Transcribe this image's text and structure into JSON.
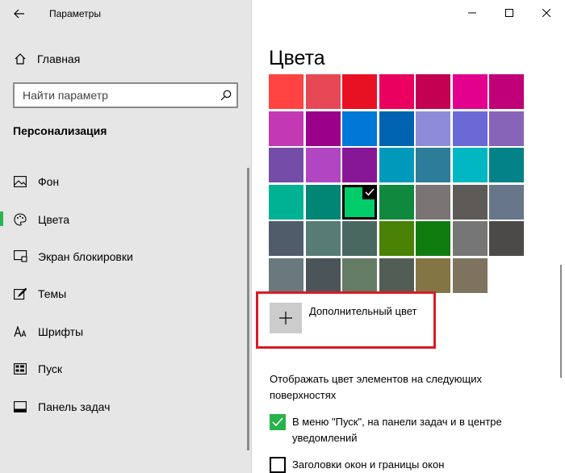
{
  "window": {
    "title": "Параметры",
    "controls": [
      "minimize",
      "maximize",
      "close"
    ]
  },
  "sidebar": {
    "home_label": "Главная",
    "search_placeholder": "Найти параметр",
    "section_heading": "Персонализация",
    "items": [
      {
        "label": "Фон",
        "icon": "picture-icon",
        "active": false
      },
      {
        "label": "Цвета",
        "icon": "palette-icon",
        "active": true
      },
      {
        "label": "Экран блокировки",
        "icon": "lock-screen-icon",
        "active": false
      },
      {
        "label": "Темы",
        "icon": "brush-icon",
        "active": false
      },
      {
        "label": "Шрифты",
        "icon": "font-icon",
        "active": false
      },
      {
        "label": "Пуск",
        "icon": "start-icon",
        "active": false
      },
      {
        "label": "Панель задач",
        "icon": "taskbar-icon",
        "active": false
      }
    ]
  },
  "main": {
    "title": "Цвета",
    "swatches": [
      [
        "#ff4343",
        "#e74856",
        "#e81123",
        "#ea005e",
        "#c30052",
        "#e3008c",
        "#bf0077"
      ],
      [
        "#c239b3",
        "#9a0089",
        "#0078d7",
        "#0063b1",
        "#8e8cd8",
        "#6b69d6",
        "#8764b8"
      ],
      [
        "#744da9",
        "#b146c2",
        "#881798",
        "#0099bc",
        "#2d7d9a",
        "#00b7c3",
        "#038387"
      ],
      [
        "#00b294",
        "#018574",
        "#00cc6a",
        "#10893e",
        "#7a7574",
        "#5d5a58",
        "#68768a"
      ],
      [
        "#515c6b",
        "#567c73",
        "#486860",
        "#498205",
        "#107c10",
        "#767676",
        "#4c4a48"
      ],
      [
        "#69797e",
        "#4a5459",
        "#647c64",
        "#525e54",
        "#847545",
        "#7e735f"
      ]
    ],
    "selected_swatch": "#00cc6a",
    "custom_color_label": "Дополнительный цвет",
    "highlight_color": "#d81b27",
    "show_color_label": "Отображать цвет элементов на следующих поверхностях",
    "checkboxes": [
      {
        "label": "В меню \"Пуск\", на панели задач и в центре уведомлений",
        "checked": true
      },
      {
        "label": "Заголовки окон и границы окон",
        "checked": false
      }
    ],
    "accent_check_color": "#27b24a"
  }
}
